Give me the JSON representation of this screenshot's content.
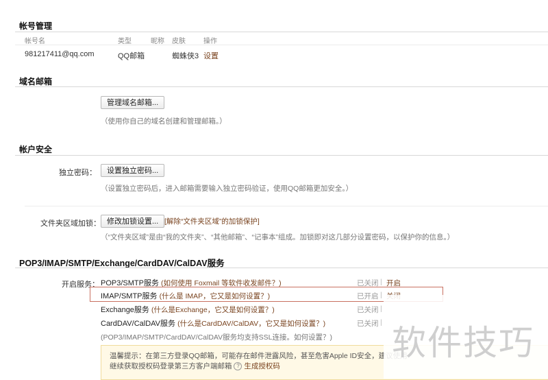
{
  "account_section": {
    "title": "帐号管理",
    "headers": [
      "帐号名",
      "类型",
      "昵称",
      "皮肤",
      "操作"
    ],
    "row": {
      "account": "981217411@qq.com",
      "type": "QQ邮箱",
      "nickname": "",
      "skin": "蜘蛛侠3",
      "action": "设置"
    }
  },
  "domain_section": {
    "title": "域名邮箱",
    "manage_button": "管理域名邮箱...",
    "note": "（使用你自己的域名创建和管理邮箱。）"
  },
  "security_section": {
    "title": "帐户安全",
    "password_label": "独立密码：",
    "password_button": "设置独立密码...",
    "password_note": "（设置独立密码后，进入邮箱需要输入独立密码验证，使用QQ邮箱更加安全。）",
    "folder_label": "文件夹区域加锁：",
    "folder_button": "修改加锁设置...",
    "unlock_link": "[解除“文件夹区域”的加锁保护]",
    "folder_note": "（“文件夹区域”是由“我的文件夹”、“其他邮箱”、“记事本”组成。加锁即对这几部分设置密码，以保护你的信息。）"
  },
  "services_section": {
    "title": "POP3/IMAP/SMTP/Exchange/CardDAV/CalDAV服务",
    "label": "开启服务：",
    "services": [
      {
        "name": "POP3/SMTP服务",
        "help": "(如何使用 Foxmail 等软件收发邮件？)",
        "state": "已关闭",
        "sep": "|",
        "action": "开启"
      },
      {
        "name": "IMAP/SMTP服务",
        "help": "(什么是 IMAP，它又是如何设置？)",
        "state": "已开启",
        "sep": "|",
        "action": "关闭"
      },
      {
        "name": "Exchange服务",
        "help": "(什么是Exchange，它又是如何设置？)",
        "state": "已关闭",
        "sep": "|",
        "action": ""
      },
      {
        "name": "CardDAV/CalDAV服务",
        "help": "(什么是CardDAV/CalDAV，它又是如何设置？)",
        "state": "已关闭",
        "sep": "|",
        "action": ""
      }
    ],
    "ssl_note": "(POP3/IMAP/SMTP/CardDAV/CalDAV服务均支持SSL连接。如何设置？)",
    "tip_line1": "温馨提示：在第三方登录QQ邮箱，可能存在邮件泄露风险，甚至危害Apple ID安全，建议使用",
    "tip_line2": "继续获取授权码登录第三方客户端邮箱",
    "tip_qmark": "?",
    "tip_generate": "生成授权码"
  },
  "watermark": "软件技巧"
}
